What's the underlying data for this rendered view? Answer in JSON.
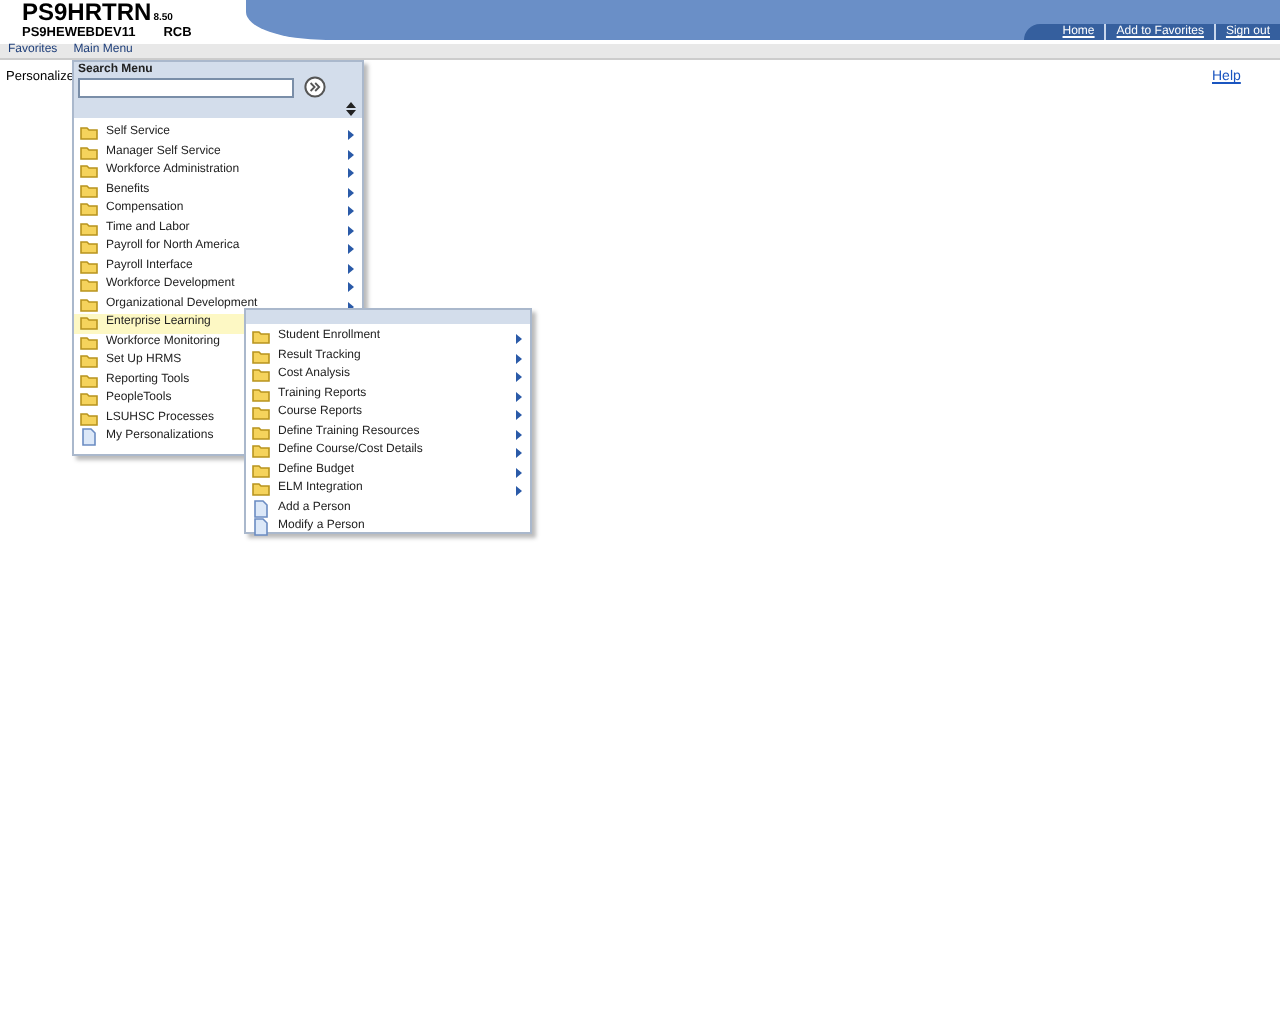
{
  "header": {
    "title": "PS9HRTRN",
    "version": "8.50",
    "server": "PS9HEWEBDEV11",
    "user": "RCB"
  },
  "top_links": [
    "Home",
    "Add to Favorites",
    "Sign out"
  ],
  "menu_bar": [
    "Favorites",
    "Main Menu"
  ],
  "page": {
    "label": "Personalize",
    "help": "Help"
  },
  "main_menu": {
    "title": "Search Menu",
    "items": [
      {
        "label": "Self Service",
        "kind": "folder",
        "selected": false
      },
      {
        "label": "Manager Self Service",
        "kind": "folder",
        "selected": false
      },
      {
        "label": "Workforce Administration",
        "kind": "folder",
        "selected": false
      },
      {
        "label": "Benefits",
        "kind": "folder",
        "selected": false
      },
      {
        "label": "Compensation",
        "kind": "folder",
        "selected": false
      },
      {
        "label": "Time and Labor",
        "kind": "folder",
        "selected": false
      },
      {
        "label": "Payroll for North America",
        "kind": "folder",
        "selected": false
      },
      {
        "label": "Payroll Interface",
        "kind": "folder",
        "selected": false
      },
      {
        "label": "Workforce Development",
        "kind": "folder",
        "selected": false
      },
      {
        "label": "Organizational Development",
        "kind": "folder",
        "selected": false
      },
      {
        "label": "Enterprise Learning",
        "kind": "open",
        "selected": true
      },
      {
        "label": "Workforce Monitoring",
        "kind": "open",
        "selected": false
      },
      {
        "label": "Set Up HRMS",
        "kind": "open",
        "selected": false
      },
      {
        "label": "Reporting Tools",
        "kind": "open",
        "selected": false
      },
      {
        "label": "PeopleTools",
        "kind": "open",
        "selected": false
      },
      {
        "label": "LSUHSC Processes",
        "kind": "open",
        "selected": false
      },
      {
        "label": "My Personalizations",
        "kind": "page",
        "selected": false
      }
    ]
  },
  "submenu": {
    "items": [
      {
        "label": "Student Enrollment",
        "kind": "folder"
      },
      {
        "label": "Result Tracking",
        "kind": "folder"
      },
      {
        "label": "Cost Analysis",
        "kind": "folder"
      },
      {
        "label": "Training Reports",
        "kind": "folder"
      },
      {
        "label": "Course Reports",
        "kind": "folder"
      },
      {
        "label": "Define Training Resources",
        "kind": "folder"
      },
      {
        "label": "Define Course/Cost Details",
        "kind": "folder"
      },
      {
        "label": "Define Budget",
        "kind": "folder"
      },
      {
        "label": "ELM Integration",
        "kind": "folder"
      },
      {
        "label": "Add a Person",
        "kind": "page"
      },
      {
        "label": "Modify a Person",
        "kind": "page"
      }
    ]
  }
}
